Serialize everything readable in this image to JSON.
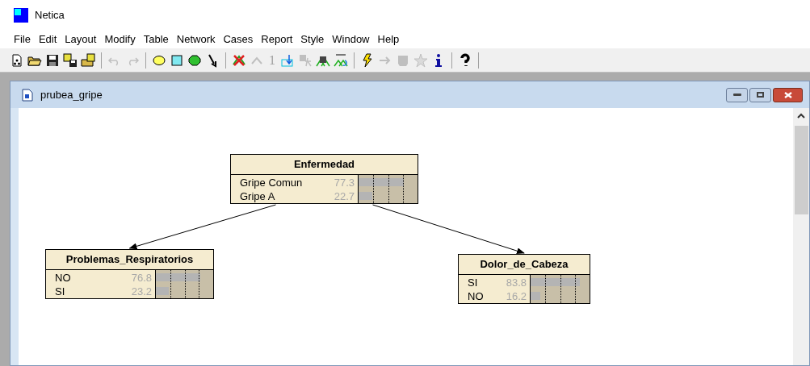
{
  "app_title": "Netica",
  "menu": [
    "File",
    "Edit",
    "Layout",
    "Modify",
    "Table",
    "Network",
    "Cases",
    "Report",
    "Style",
    "Window",
    "Help"
  ],
  "toolbar": [
    {
      "kind": "new",
      "disabled": false
    },
    {
      "kind": "open",
      "disabled": false
    },
    {
      "kind": "save",
      "disabled": false
    },
    {
      "kind": "save-grid",
      "disabled": false
    },
    {
      "kind": "open-grid",
      "disabled": false
    },
    {
      "kind": "sep"
    },
    {
      "kind": "undo",
      "disabled": true
    },
    {
      "kind": "redo",
      "disabled": true
    },
    {
      "kind": "sep"
    },
    {
      "kind": "ellipse",
      "disabled": false
    },
    {
      "kind": "square",
      "disabled": false
    },
    {
      "kind": "octagon",
      "disabled": false
    },
    {
      "kind": "arrow",
      "disabled": false
    },
    {
      "kind": "sep"
    },
    {
      "kind": "delete",
      "disabled": false
    },
    {
      "kind": "caret",
      "disabled": true
    },
    {
      "kind": "text",
      "label": "1",
      "disabled": true
    },
    {
      "kind": "import",
      "disabled": false
    },
    {
      "kind": "absorb",
      "disabled": true
    },
    {
      "kind": "table",
      "disabled": false
    },
    {
      "kind": "function",
      "disabled": false
    },
    {
      "kind": "sep"
    },
    {
      "kind": "compile",
      "disabled": false
    },
    {
      "kind": "right",
      "disabled": true
    },
    {
      "kind": "block",
      "disabled": true
    },
    {
      "kind": "star",
      "disabled": true
    },
    {
      "kind": "info",
      "disabled": false
    },
    {
      "kind": "sep"
    },
    {
      "kind": "help",
      "disabled": false
    },
    {
      "kind": "sep"
    }
  ],
  "document": {
    "title": "prubea_gripe",
    "nodes": [
      {
        "title": "Enfermedad",
        "states": [
          {
            "label": "Gripe Comun",
            "value": "77.3",
            "level": 0.773
          },
          {
            "label": "Gripe A",
            "value": "22.7",
            "level": 0.227
          }
        ]
      },
      {
        "title": "Problemas_Respiratorios",
        "states": [
          {
            "label": "NO",
            "value": "76.8",
            "level": 0.768
          },
          {
            "label": "SI",
            "value": "23.2",
            "level": 0.232
          }
        ]
      },
      {
        "title": "Dolor_de_Cabeza",
        "states": [
          {
            "label": "SI",
            "value": "83.8",
            "level": 0.838
          },
          {
            "label": "NO",
            "value": "16.2",
            "level": 0.162
          }
        ]
      }
    ]
  }
}
